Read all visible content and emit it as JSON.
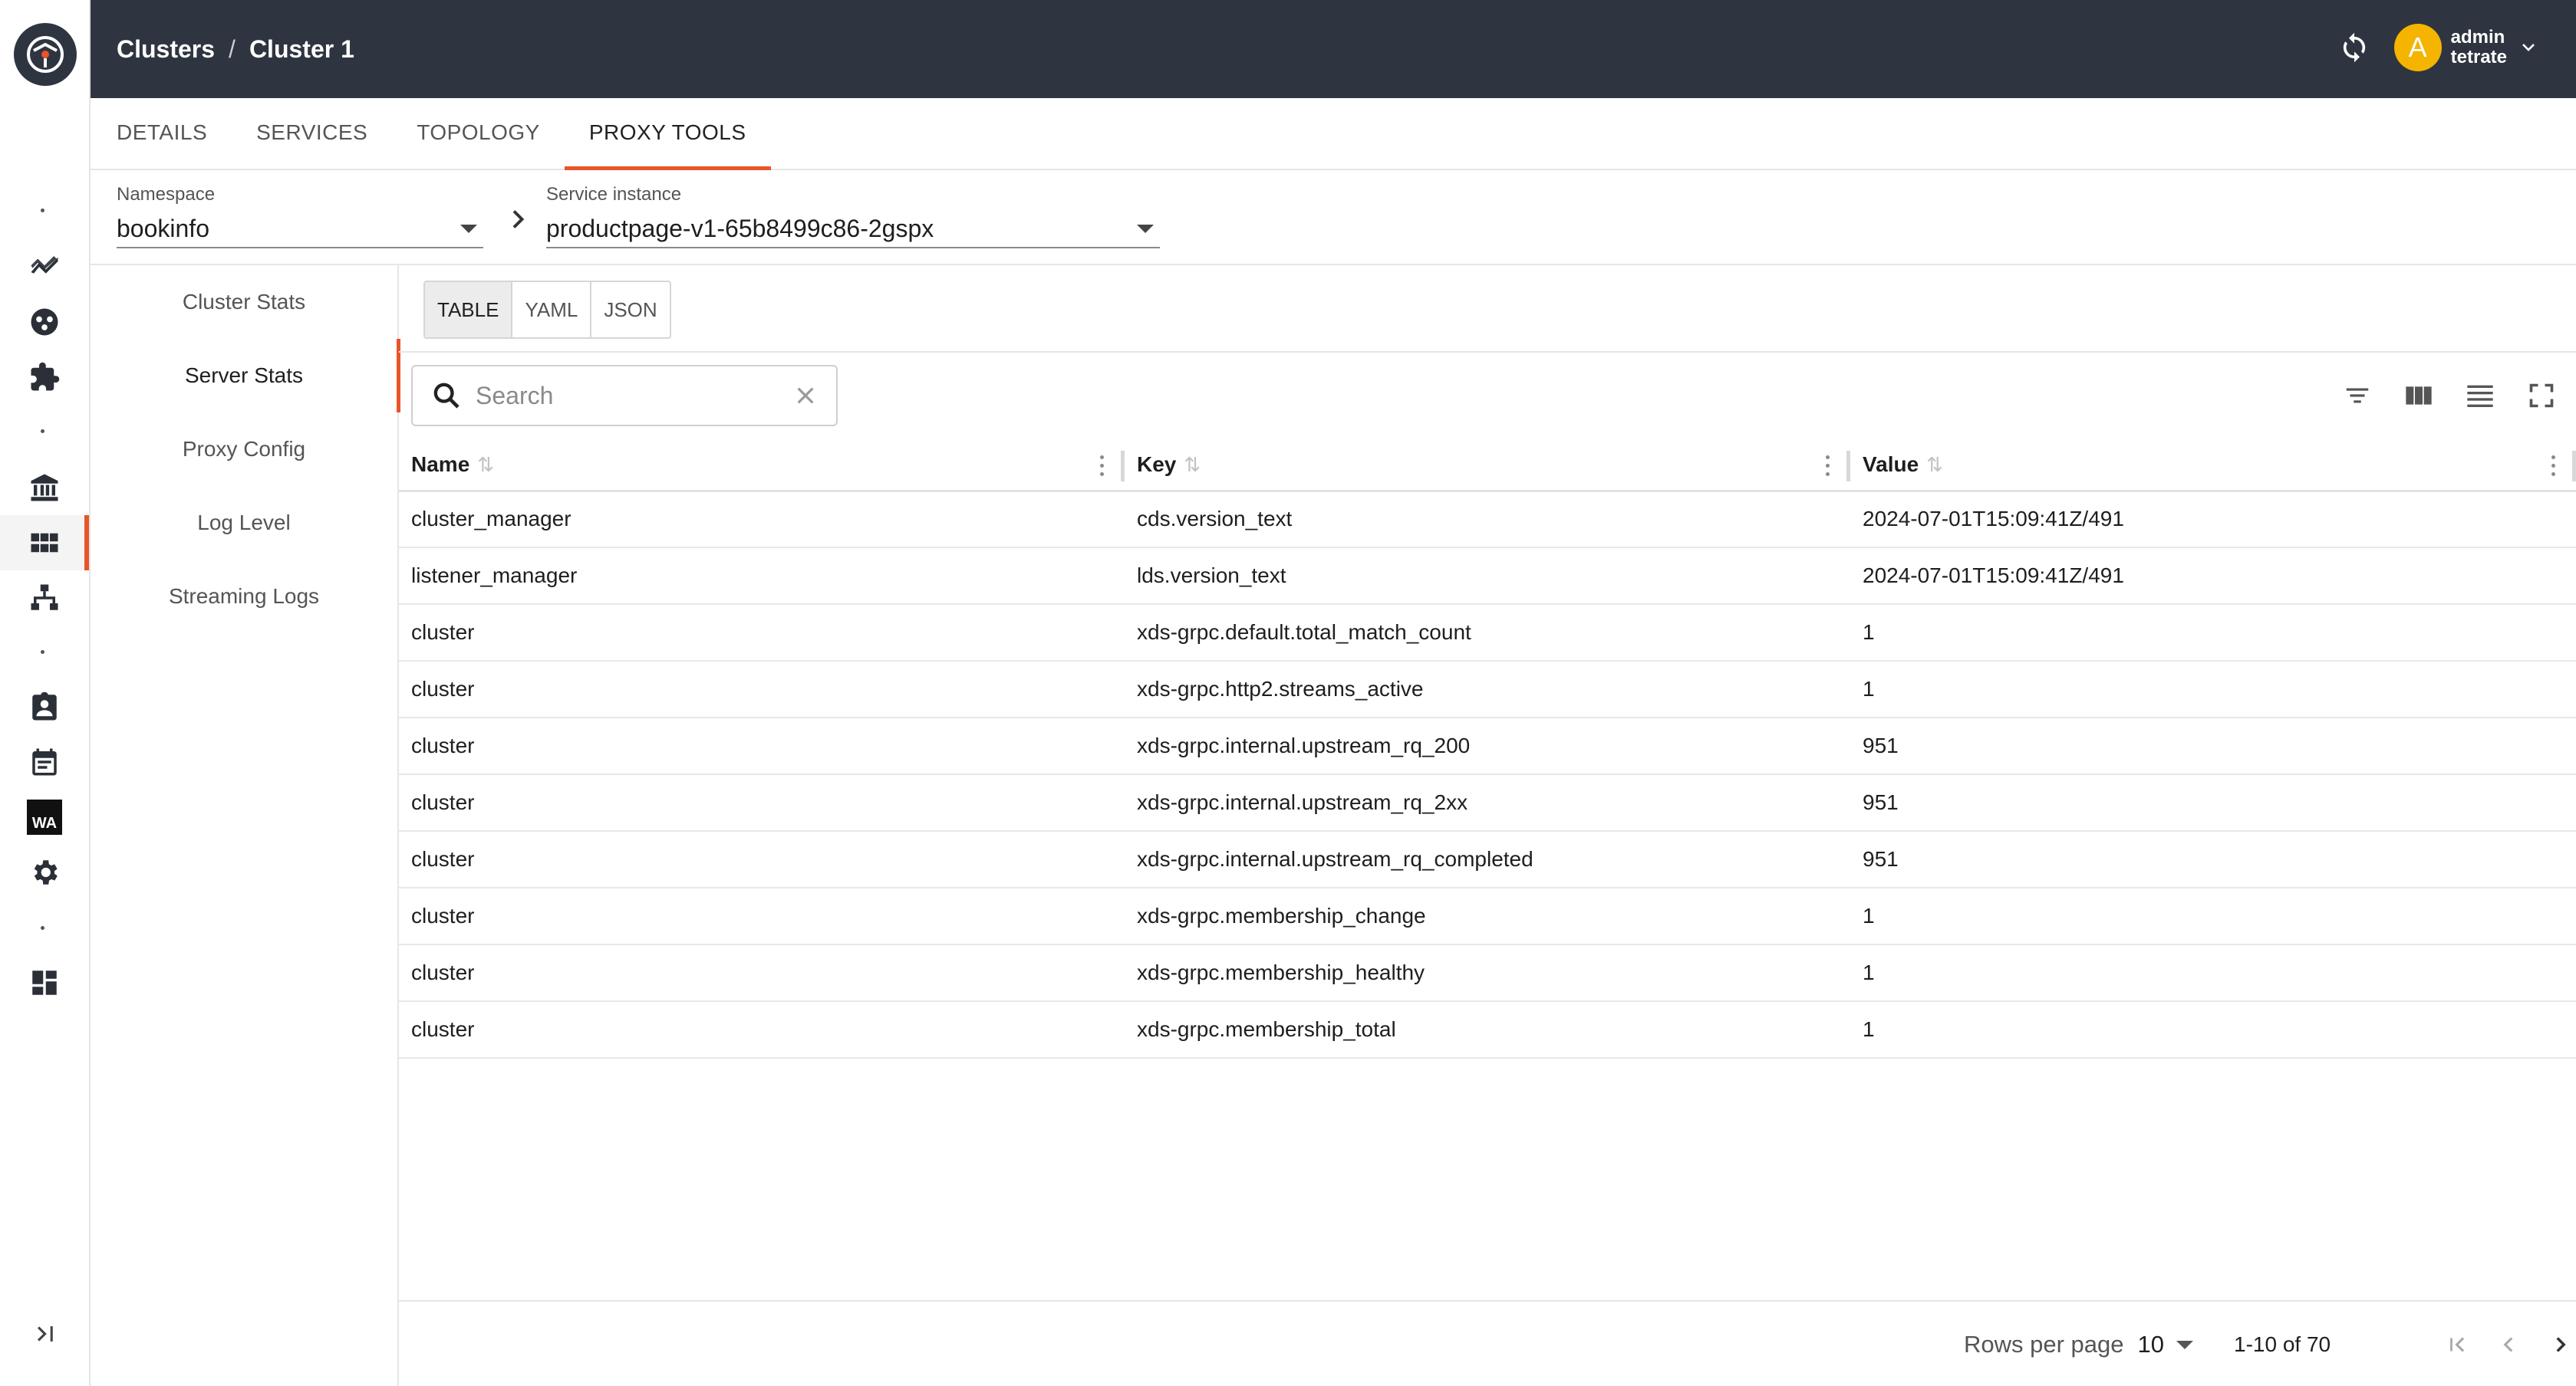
{
  "colors": {
    "accent": "#e8552a",
    "topbar": "#2f3540",
    "avatar": "#f5b400"
  },
  "rail": {
    "items": [
      "logo-icon",
      "metrics-icon",
      "workspace-icon",
      "extensions-icon",
      "institution-icon",
      "clusters-icon",
      "topology-icon",
      "identity-icon",
      "calendar-icon",
      "wa-icon",
      "settings-icon",
      "dashboard-icon"
    ],
    "wa_label": "WA"
  },
  "breadcrumb": {
    "parent": "Clusters",
    "separator": "/",
    "current": "Cluster 1"
  },
  "user": {
    "initial": "A",
    "name": "admin",
    "org": "tetrate"
  },
  "tabs": [
    "DETAILS",
    "SERVICES",
    "TOPOLOGY",
    "PROXY TOOLS"
  ],
  "active_tab": "PROXY TOOLS",
  "namespace": {
    "label": "Namespace",
    "value": "bookinfo"
  },
  "service_instance": {
    "label": "Service instance",
    "value": "productpage-v1-65b8499c86-2gspx"
  },
  "subnav": [
    "Cluster Stats",
    "Server Stats",
    "Proxy Config",
    "Log Level",
    "Streaming Logs"
  ],
  "active_subnav": "Server Stats",
  "format_options": [
    "TABLE",
    "YAML",
    "JSON"
  ],
  "active_format": "TABLE",
  "search": {
    "placeholder": "Search"
  },
  "table": {
    "columns": [
      "Name",
      "Key",
      "Value"
    ],
    "rows": [
      [
        "cluster_manager",
        "cds.version_text",
        "2024-07-01T15:09:41Z/491"
      ],
      [
        "listener_manager",
        "lds.version_text",
        "2024-07-01T15:09:41Z/491"
      ],
      [
        "cluster",
        "xds-grpc.default.total_match_count",
        "1"
      ],
      [
        "cluster",
        "xds-grpc.http2.streams_active",
        "1"
      ],
      [
        "cluster",
        "xds-grpc.internal.upstream_rq_200",
        "951"
      ],
      [
        "cluster",
        "xds-grpc.internal.upstream_rq_2xx",
        "951"
      ],
      [
        "cluster",
        "xds-grpc.internal.upstream_rq_completed",
        "951"
      ],
      [
        "cluster",
        "xds-grpc.membership_change",
        "1"
      ],
      [
        "cluster",
        "xds-grpc.membership_healthy",
        "1"
      ],
      [
        "cluster",
        "xds-grpc.membership_total",
        "1"
      ]
    ]
  },
  "pagination": {
    "rows_per_page_label": "Rows per page",
    "rows_per_page": "10",
    "range": "1-10 of 70"
  }
}
